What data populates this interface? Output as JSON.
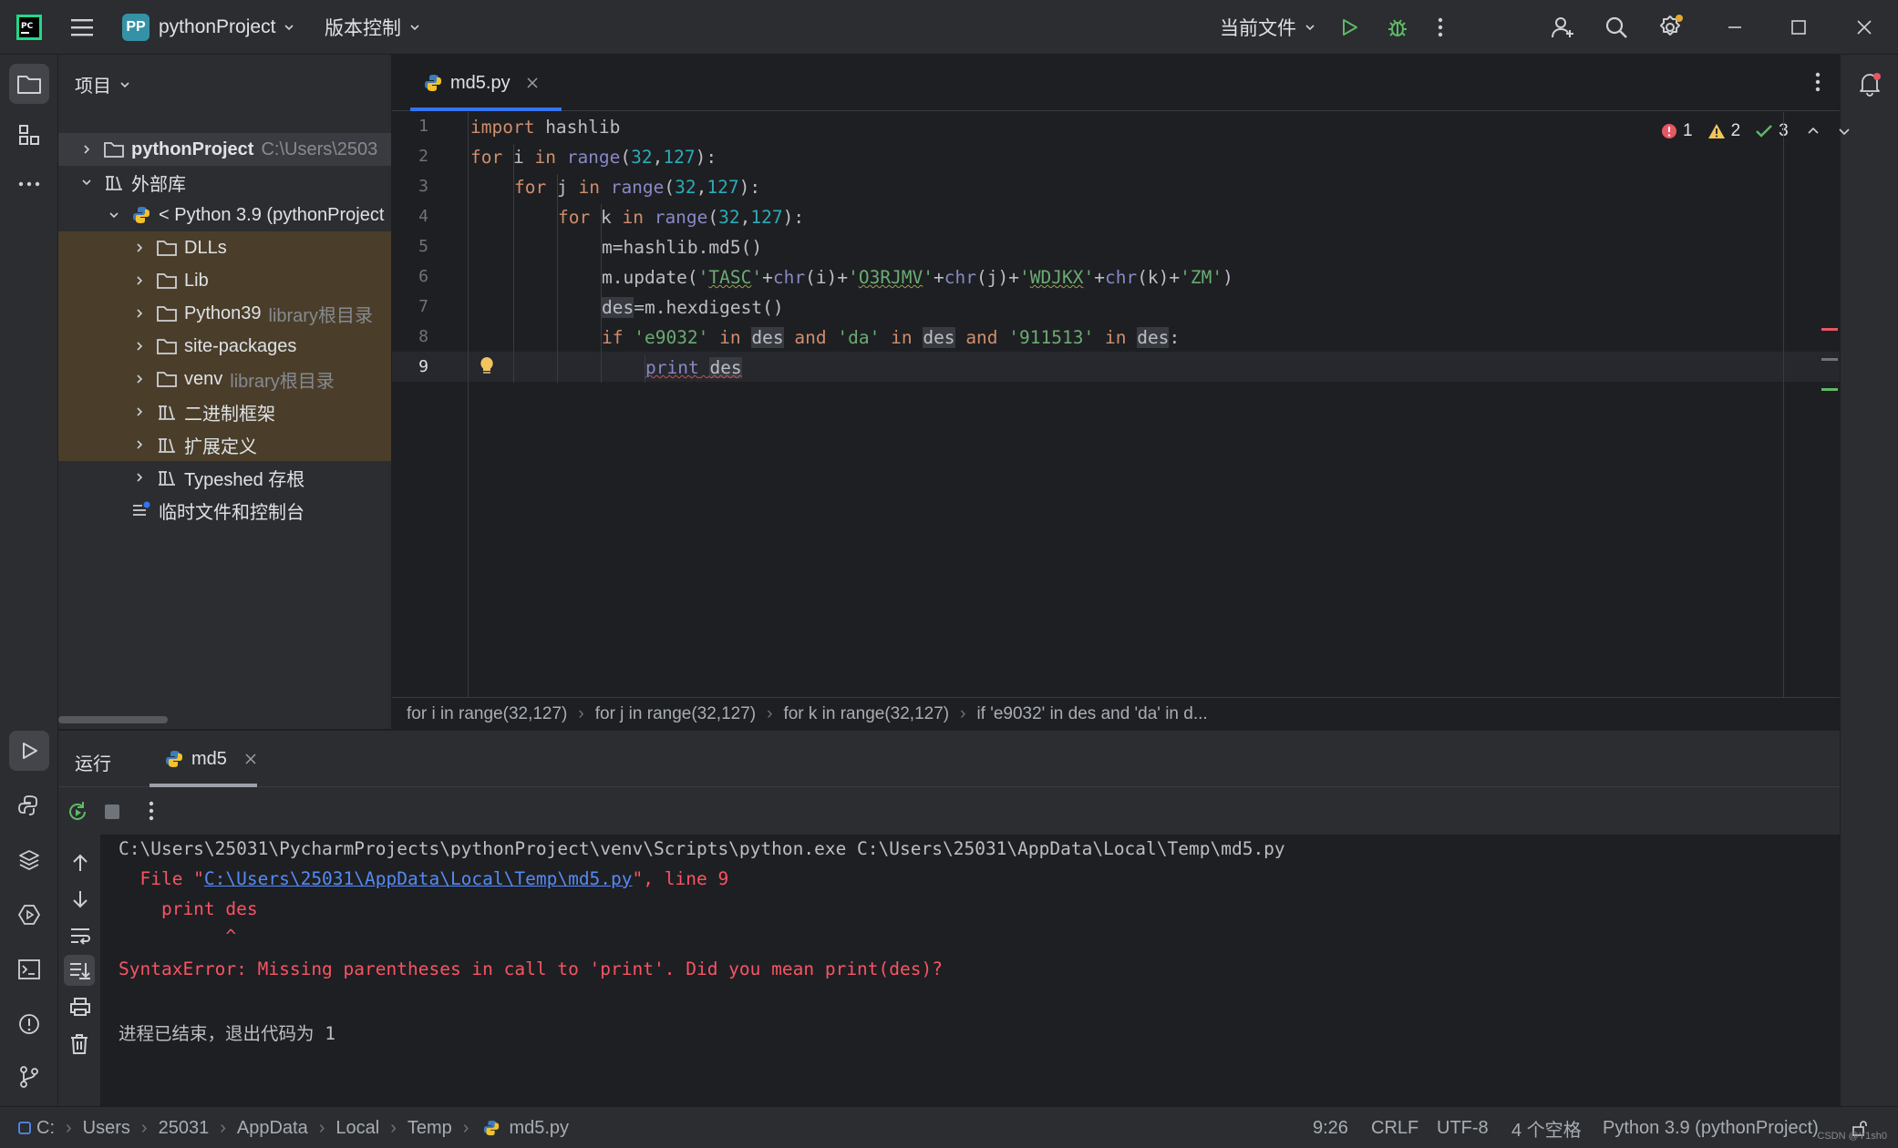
{
  "titlebar": {
    "project_badge": "PP",
    "project_name": "pythonProject",
    "vcs": "版本控制",
    "run_config": "当前文件"
  },
  "project_panel": {
    "title": "项目",
    "tree": [
      {
        "label": "pythonProject",
        "hint": "C:\\Users\\2503"
      },
      {
        "label": "外部库",
        "hint": ""
      },
      {
        "label": "< Python 3.9 (pythonProject",
        "hint": ""
      },
      {
        "label": "DLLs",
        "hint": ""
      },
      {
        "label": "Lib",
        "hint": ""
      },
      {
        "label": "Python39",
        "hint": "library根目录"
      },
      {
        "label": "site-packages",
        "hint": ""
      },
      {
        "label": "venv",
        "hint": "library根目录"
      },
      {
        "label": "二进制框架",
        "hint": ""
      },
      {
        "label": "扩展定义",
        "hint": ""
      },
      {
        "label": "Typeshed 存根",
        "hint": ""
      },
      {
        "label": "临时文件和控制台",
        "hint": ""
      }
    ]
  },
  "editor": {
    "tab": "md5.py",
    "inspections": {
      "errors": "1",
      "warnings": "2",
      "ok": "3"
    },
    "line_numbers": [
      "1",
      "2",
      "3",
      "4",
      "5",
      "6",
      "7",
      "8",
      "9"
    ],
    "code": {
      "l1": [
        "import",
        " hashlib"
      ],
      "l2": [
        "for",
        " i ",
        "in",
        " ",
        "range",
        "(",
        "32",
        ",",
        "127",
        "):"
      ],
      "l3": [
        "for",
        " j ",
        "in",
        " ",
        "range",
        "(",
        "32",
        ",",
        "127",
        "):"
      ],
      "l4": [
        "for",
        " k ",
        "in",
        " ",
        "range",
        "(",
        "32",
        ",",
        "127",
        "):"
      ],
      "l5": [
        "m=hashlib.md5()"
      ],
      "l6": [
        "m.update(",
        "'",
        "TASC",
        "'",
        "+",
        "chr",
        "(i)+",
        "'",
        "O3RJMV",
        "'",
        "+",
        "chr",
        "(j)+",
        "'",
        "WDJKX",
        "'",
        "+",
        "chr",
        "(k)+",
        "'ZM'",
        ")"
      ],
      "l7": [
        "des",
        "=m.hexdigest()"
      ],
      "l8": [
        "if",
        " ",
        "'e9032'",
        " ",
        "in",
        " ",
        "des",
        " ",
        "and",
        " ",
        "'da'",
        " ",
        "in",
        " ",
        "des",
        " ",
        "and",
        " ",
        "'911513'",
        " ",
        "in",
        " ",
        "des",
        ":"
      ],
      "l9": [
        "print",
        " ",
        "des"
      ]
    },
    "breadcrumbs": [
      "for i in range(32,127)",
      "for j in range(32,127)",
      "for k in range(32,127)",
      "if 'e9032' in des and 'da' in d..."
    ]
  },
  "run": {
    "title": "运行",
    "tab": "md5",
    "console": {
      "cmd": "C:\\Users\\25031\\PycharmProjects\\pythonProject\\venv\\Scripts\\python.exe C:\\Users\\25031\\AppData\\Local\\Temp\\md5.py",
      "file_pre": "  File \"",
      "file_link": "C:\\Users\\25031\\AppData\\Local\\Temp\\md5.py",
      "file_post": "\", line 9",
      "code_line": "    print des",
      "caret": "          ^",
      "error": "SyntaxError: Missing parentheses in call to 'print'. Did you mean print(des)?",
      "exit": "进程已结束，退出代码为 1"
    }
  },
  "statusbar": {
    "path": [
      "C:",
      "Users",
      "25031",
      "AppData",
      "Local",
      "Temp",
      "md5.py"
    ],
    "position": "9:26",
    "line_sep": "CRLF",
    "encoding": "UTF-8",
    "indent": "4 个空格",
    "interpreter": "Python 3.9 (pythonProject)",
    "watermark": "CSDN @Y1sh0"
  },
  "colors": {
    "accent": "#3574f0",
    "error": "#f75464",
    "library_bg": "#4a3e2a"
  }
}
